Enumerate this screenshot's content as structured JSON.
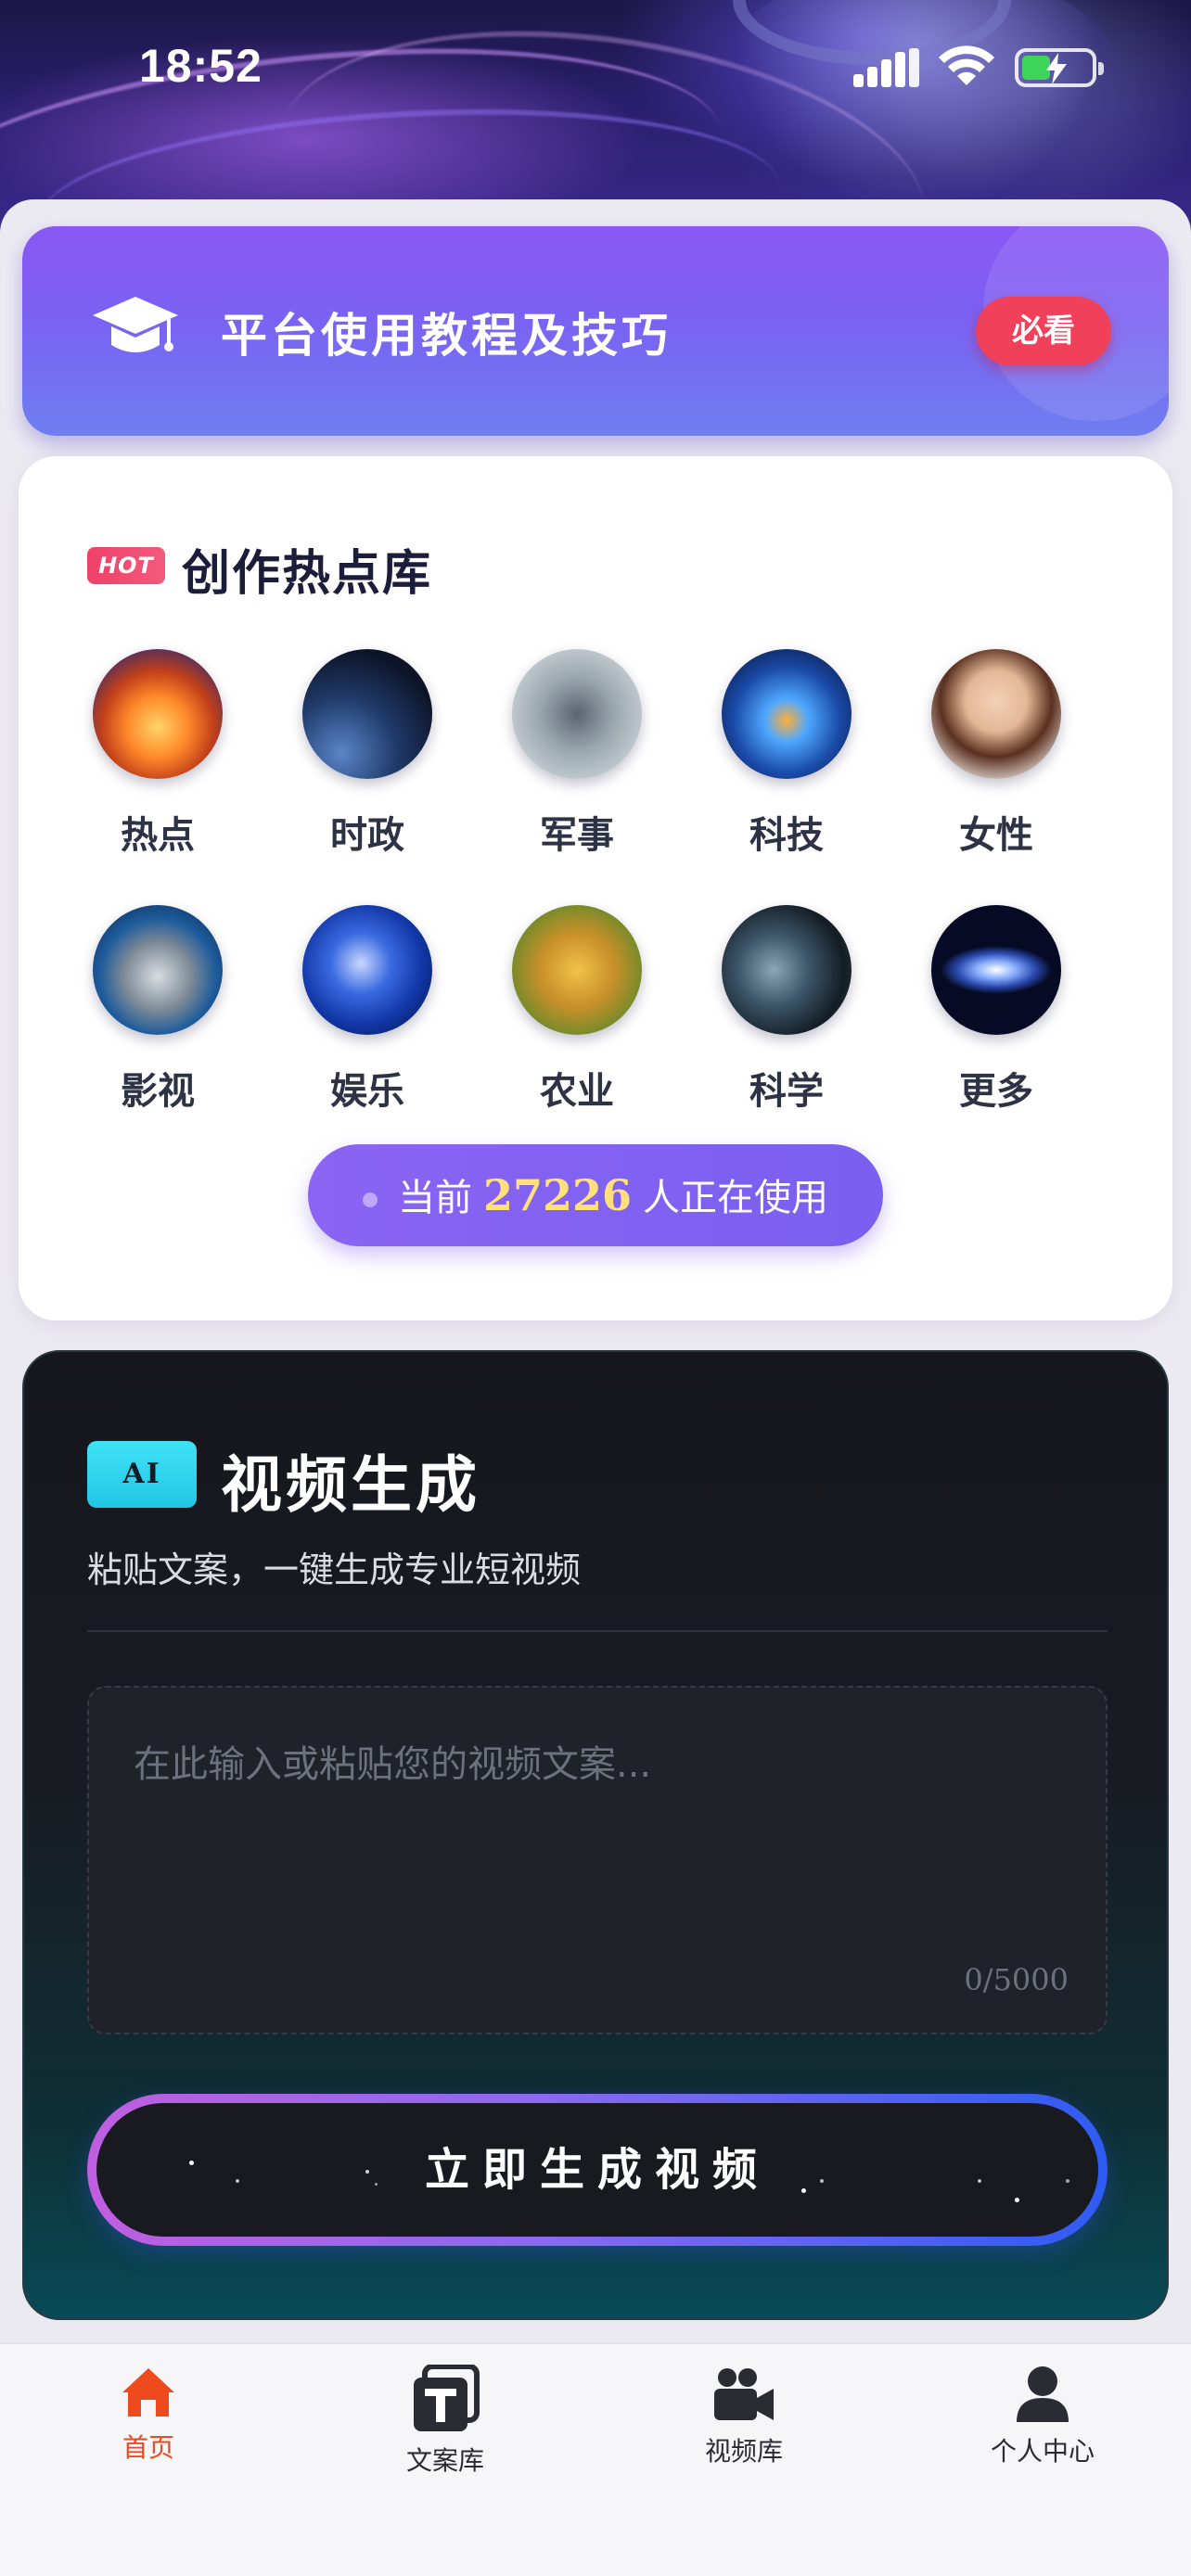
{
  "status_bar": {
    "time": "18:52"
  },
  "tutorial_banner": {
    "title": "平台使用教程及技巧",
    "badge": "必看"
  },
  "hot_library": {
    "badge": "HOT",
    "title": "创作热点库",
    "categories": [
      {
        "label": "热点",
        "icon": "bonfire-image"
      },
      {
        "label": "时政",
        "icon": "satellite-earth-image"
      },
      {
        "label": "军事",
        "icon": "fighter-jet-image"
      },
      {
        "label": "科技",
        "icon": "circuit-chip-image"
      },
      {
        "label": "女性",
        "icon": "woman-portrait-image"
      },
      {
        "label": "影视",
        "icon": "film-clapper-image"
      },
      {
        "label": "娱乐",
        "icon": "microphone-image"
      },
      {
        "label": "农业",
        "icon": "wheat-image"
      },
      {
        "label": "科学",
        "icon": "planet-image"
      },
      {
        "label": "更多",
        "icon": "galaxy-image"
      }
    ],
    "users": {
      "prefix": "当前",
      "count": "27226",
      "suffix": "人正在使用"
    }
  },
  "ai_video": {
    "badge": "AI",
    "title": "视频生成",
    "subtitle": "粘贴文案，一键生成专业短视频",
    "textarea": {
      "placeholder": "在此输入或粘贴您的视频文案...",
      "value": ""
    },
    "char_count": "0/5000",
    "button_label": "立即生成视频"
  },
  "tab_bar": {
    "items": [
      {
        "label": "首页",
        "icon": "home-icon",
        "active": true
      },
      {
        "label": "文案库",
        "icon": "text-library-icon",
        "active": false
      },
      {
        "label": "视频库",
        "icon": "video-camera-icon",
        "active": false
      },
      {
        "label": "个人中心",
        "icon": "user-icon",
        "active": false
      }
    ]
  },
  "colors": {
    "accent_purple": "#8a57f5",
    "hot_red": "#f0405a",
    "ai_cyan": "#3fe2f5",
    "active_tab": "#ef4a1e",
    "count_gold": "#ffe07a"
  }
}
